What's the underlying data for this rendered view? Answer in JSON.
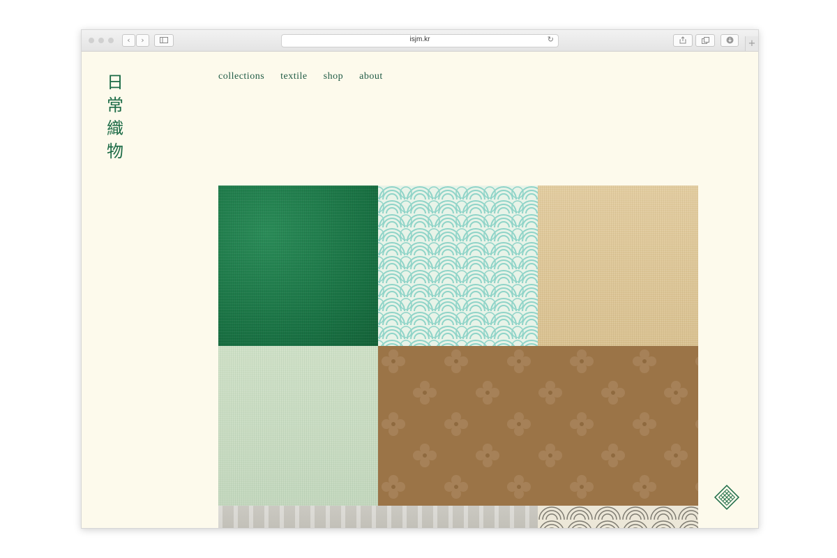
{
  "browser": {
    "url": "isjm.kr",
    "buttons": {
      "back": "‹",
      "forward": "›",
      "reload": "↻",
      "new_tab": "+"
    }
  },
  "site": {
    "logo": [
      "日",
      "常",
      "織",
      "物"
    ],
    "nav": [
      {
        "label": "collections"
      },
      {
        "label": "textile"
      },
      {
        "label": "shop"
      },
      {
        "label": "about"
      }
    ]
  },
  "tiles": [
    {
      "name": "green-linen",
      "color": "#1f7a4a"
    },
    {
      "name": "mint-wave-pattern",
      "color": "#d8eee0"
    },
    {
      "name": "beige-linen",
      "color": "#dfc89a"
    },
    {
      "name": "pale-green-linen",
      "color": "#c9dcc2"
    },
    {
      "name": "brown-flower-pattern",
      "color": "#9c7346"
    },
    {
      "name": "grey-cable-pattern",
      "color": "#c8c6bf"
    },
    {
      "name": "grey-wave-pattern",
      "color": "#e8e4d6"
    }
  ],
  "colors": {
    "page_bg": "#fdfaec",
    "brand_green": "#1c6b46"
  }
}
